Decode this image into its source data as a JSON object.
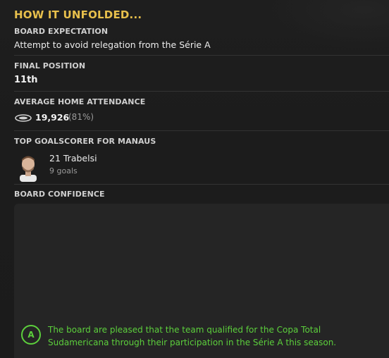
{
  "title": "HOW IT UNFOLDED...",
  "board_expectation": {
    "label": "BOARD EXPECTATION",
    "value": "Attempt to avoid relegation from the Série A"
  },
  "final_position": {
    "label": "FINAL POSITION",
    "value": "11th"
  },
  "attendance": {
    "label": "AVERAGE HOME ATTENDANCE",
    "icon": "stadium-icon",
    "value": "19,926",
    "percent": "(81%)"
  },
  "top_scorer": {
    "label": "TOP GOALSCORER FOR MANAUS",
    "name": "21 Trabelsi",
    "goals": "9 goals"
  },
  "board_confidence": {
    "label": "BOARD CONFIDENCE",
    "grade": "A",
    "message": "The board are pleased that the team qualified for the Copa Total Sudamericana through their participation in the Série A this season."
  },
  "colors": {
    "accent": "#e8c04c",
    "positive": "#5ccf3c",
    "background": "#1c1c1c"
  }
}
